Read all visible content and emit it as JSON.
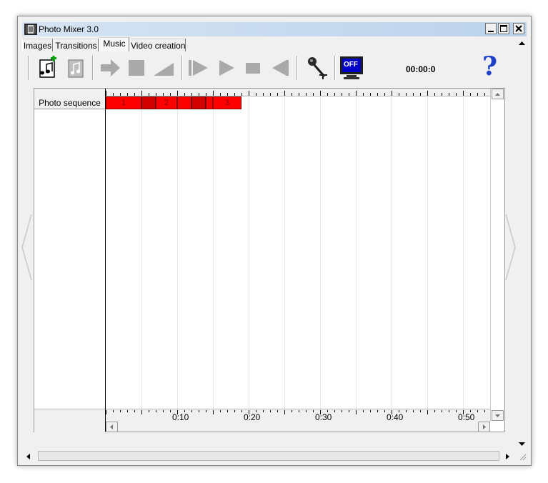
{
  "window": {
    "title": "Photo Mixer 3.0",
    "controls": {
      "minimize": "_",
      "maximize": "□",
      "close": "✕"
    }
  },
  "tabs": [
    {
      "label": "Images",
      "active": false
    },
    {
      "label": "Transitions",
      "active": false
    },
    {
      "label": "Music",
      "active": true
    },
    {
      "label": "Video creation",
      "active": false
    }
  ],
  "toolbar": {
    "time_display": "00:00:0",
    "tools": [
      {
        "name": "add-music-icon",
        "enabled": true
      },
      {
        "name": "remove-music-icon",
        "enabled": false
      },
      {
        "name": "forward-arrow-icon",
        "enabled": false
      },
      {
        "name": "stop-square-icon",
        "enabled": false
      },
      {
        "name": "volume-ramp-icon",
        "enabled": false
      },
      {
        "name": "skip-start-icon",
        "enabled": false
      },
      {
        "name": "play-icon",
        "enabled": false
      },
      {
        "name": "stop-icon",
        "enabled": false
      },
      {
        "name": "rewind-icon",
        "enabled": false
      },
      {
        "name": "microphone-icon",
        "enabled": true
      },
      {
        "name": "monitor-off-icon",
        "enabled": true,
        "label": "OFF"
      },
      {
        "name": "help-icon",
        "enabled": true,
        "label": "?"
      }
    ]
  },
  "timeline": {
    "track_label": "Photo sequence",
    "time_labels": [
      "0:10",
      "0:20",
      "0:30",
      "0:40",
      "0:50"
    ],
    "blocks": [
      {
        "label": "1",
        "start_s": 0.0,
        "end_s": 5.0,
        "kind": "photo"
      },
      {
        "label": "",
        "start_s": 5.0,
        "end_s": 7.0,
        "kind": "transition"
      },
      {
        "label": "2",
        "start_s": 7.0,
        "end_s": 10.0,
        "kind": "photo"
      },
      {
        "label": "",
        "start_s": 10.0,
        "end_s": 12.0,
        "kind": "photo"
      },
      {
        "label": "",
        "start_s": 12.0,
        "end_s": 14.0,
        "kind": "transition"
      },
      {
        "label": "",
        "start_s": 14.0,
        "end_s": 15.0,
        "kind": "photo"
      },
      {
        "label": "3",
        "start_s": 15.0,
        "end_s": 19.0,
        "kind": "photo"
      }
    ]
  },
  "colors": {
    "block_red": "#ff0000",
    "transition_red": "#d40000",
    "titlebar": "#c8daef",
    "face": "#f0f0f0"
  }
}
